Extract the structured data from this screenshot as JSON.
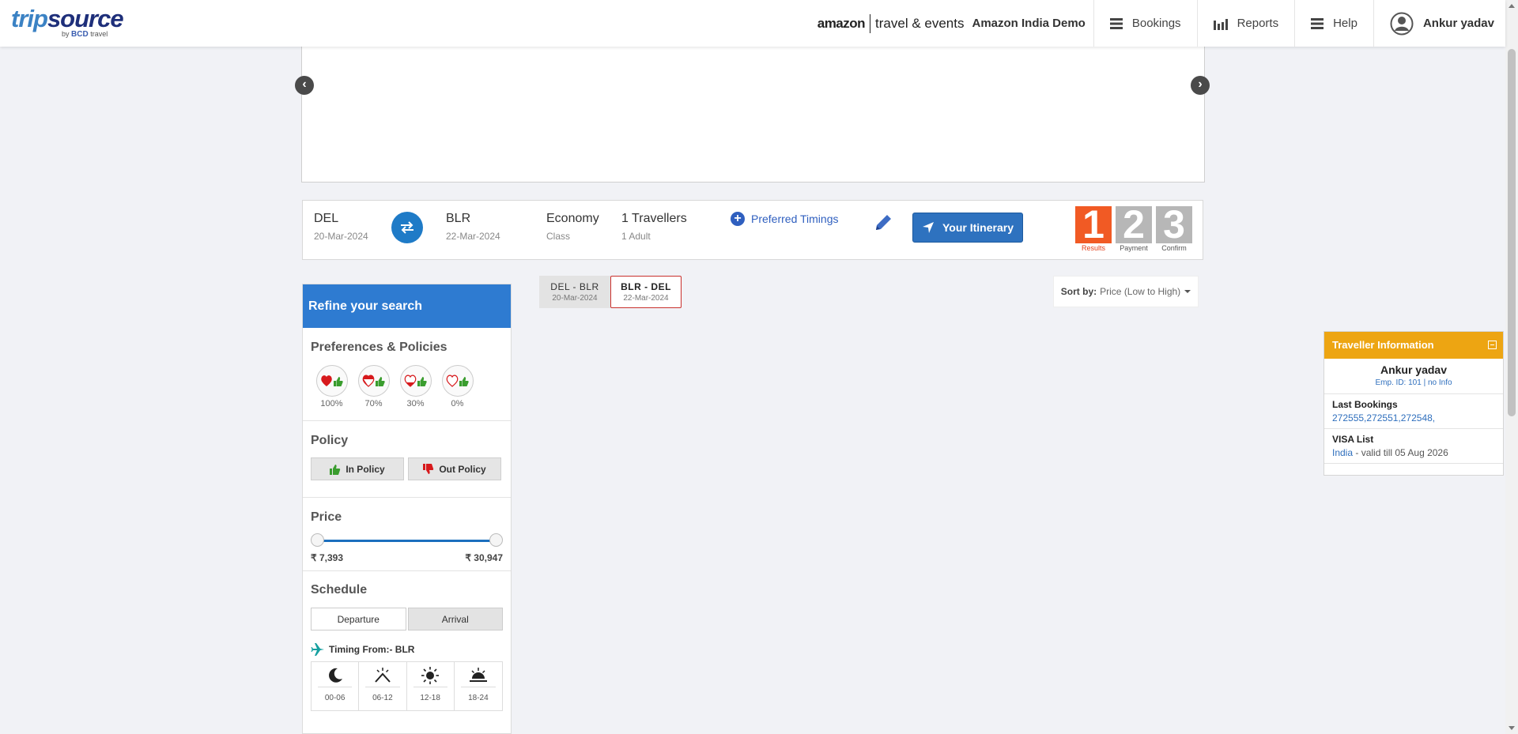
{
  "header": {
    "logo_trip": "trip",
    "logo_source": "source",
    "logo_by": "by",
    "logo_bcd": "BCD",
    "logo_travel": "travel",
    "amazon_logo": "amazon",
    "amazon_tagline": "travel & events",
    "company_name": "Amazon India Demo",
    "nav": [
      {
        "label": "Bookings",
        "icon": "menu-icon"
      },
      {
        "label": "Reports",
        "icon": "bar-chart-icon"
      },
      {
        "label": "Help",
        "icon": "menu-icon"
      }
    ],
    "user_name": "Ankur yadav"
  },
  "banner": {
    "prev_glyph": "‹",
    "next_glyph": "›"
  },
  "search": {
    "origin": "DEL",
    "depart_date": "20-Mar-2024",
    "destination": "BLR",
    "return_date": "22-Mar-2024",
    "cabin": "Economy",
    "cabin_sub": "Class",
    "travellers": "1 Travellers",
    "travellers_sub": "1 Adult",
    "preferred_timings": "Preferred Timings",
    "itinerary_button": "Your Itinerary"
  },
  "steps": [
    {
      "num": "1",
      "label": "Results",
      "state": "active"
    },
    {
      "num": "2",
      "label": "Payment",
      "state": "inactive"
    },
    {
      "num": "3",
      "label": "Confirm",
      "state": "inactive"
    }
  ],
  "refine": {
    "title": "Refine your search",
    "preferences_title": "Preferences & Policies",
    "preferences": [
      {
        "label": "100%",
        "hearts": "full"
      },
      {
        "label": "70%",
        "hearts": "mostly"
      },
      {
        "label": "30%",
        "hearts": "partial"
      },
      {
        "label": "0%",
        "hearts": "empty"
      }
    ],
    "policy_title": "Policy",
    "in_policy": "In Policy",
    "out_policy": "Out Policy",
    "price_title": "Price",
    "price_min": "₹ 7,393",
    "price_max": "₹ 30,947",
    "schedule_title": "Schedule",
    "departure": "Departure",
    "arrival": "Arrival",
    "timing_from": "Timing From:- BLR",
    "time_slots": [
      {
        "label": "00-06",
        "icon": "moon-icon"
      },
      {
        "label": "06-12",
        "icon": "sunrise-icon"
      },
      {
        "label": "12-18",
        "icon": "sun-icon"
      },
      {
        "label": "18-24",
        "icon": "sunset-icon"
      }
    ]
  },
  "sectors": [
    {
      "route": "DEL - BLR",
      "date": "20-Mar-2024",
      "active": false
    },
    {
      "route": "BLR - DEL",
      "date": "22-Mar-2024",
      "active": true
    }
  ],
  "sort": {
    "label": "Sort by:",
    "value": "Price (Low to High)"
  },
  "traveller": {
    "title": "Traveller Information",
    "name": "Ankur yadav",
    "emp_id": "Emp. ID: 101 | no Info",
    "last_bookings_label": "Last Bookings",
    "last_bookings": "272555,272551,272548,",
    "visa_label": "VISA List",
    "visa_country": "India",
    "visa_valid": " - valid till 05 Aug 2026"
  },
  "colors": {
    "primary_blue": "#2e7bd1",
    "step_active": "#f15a24",
    "traveller_header": "#eda512"
  }
}
